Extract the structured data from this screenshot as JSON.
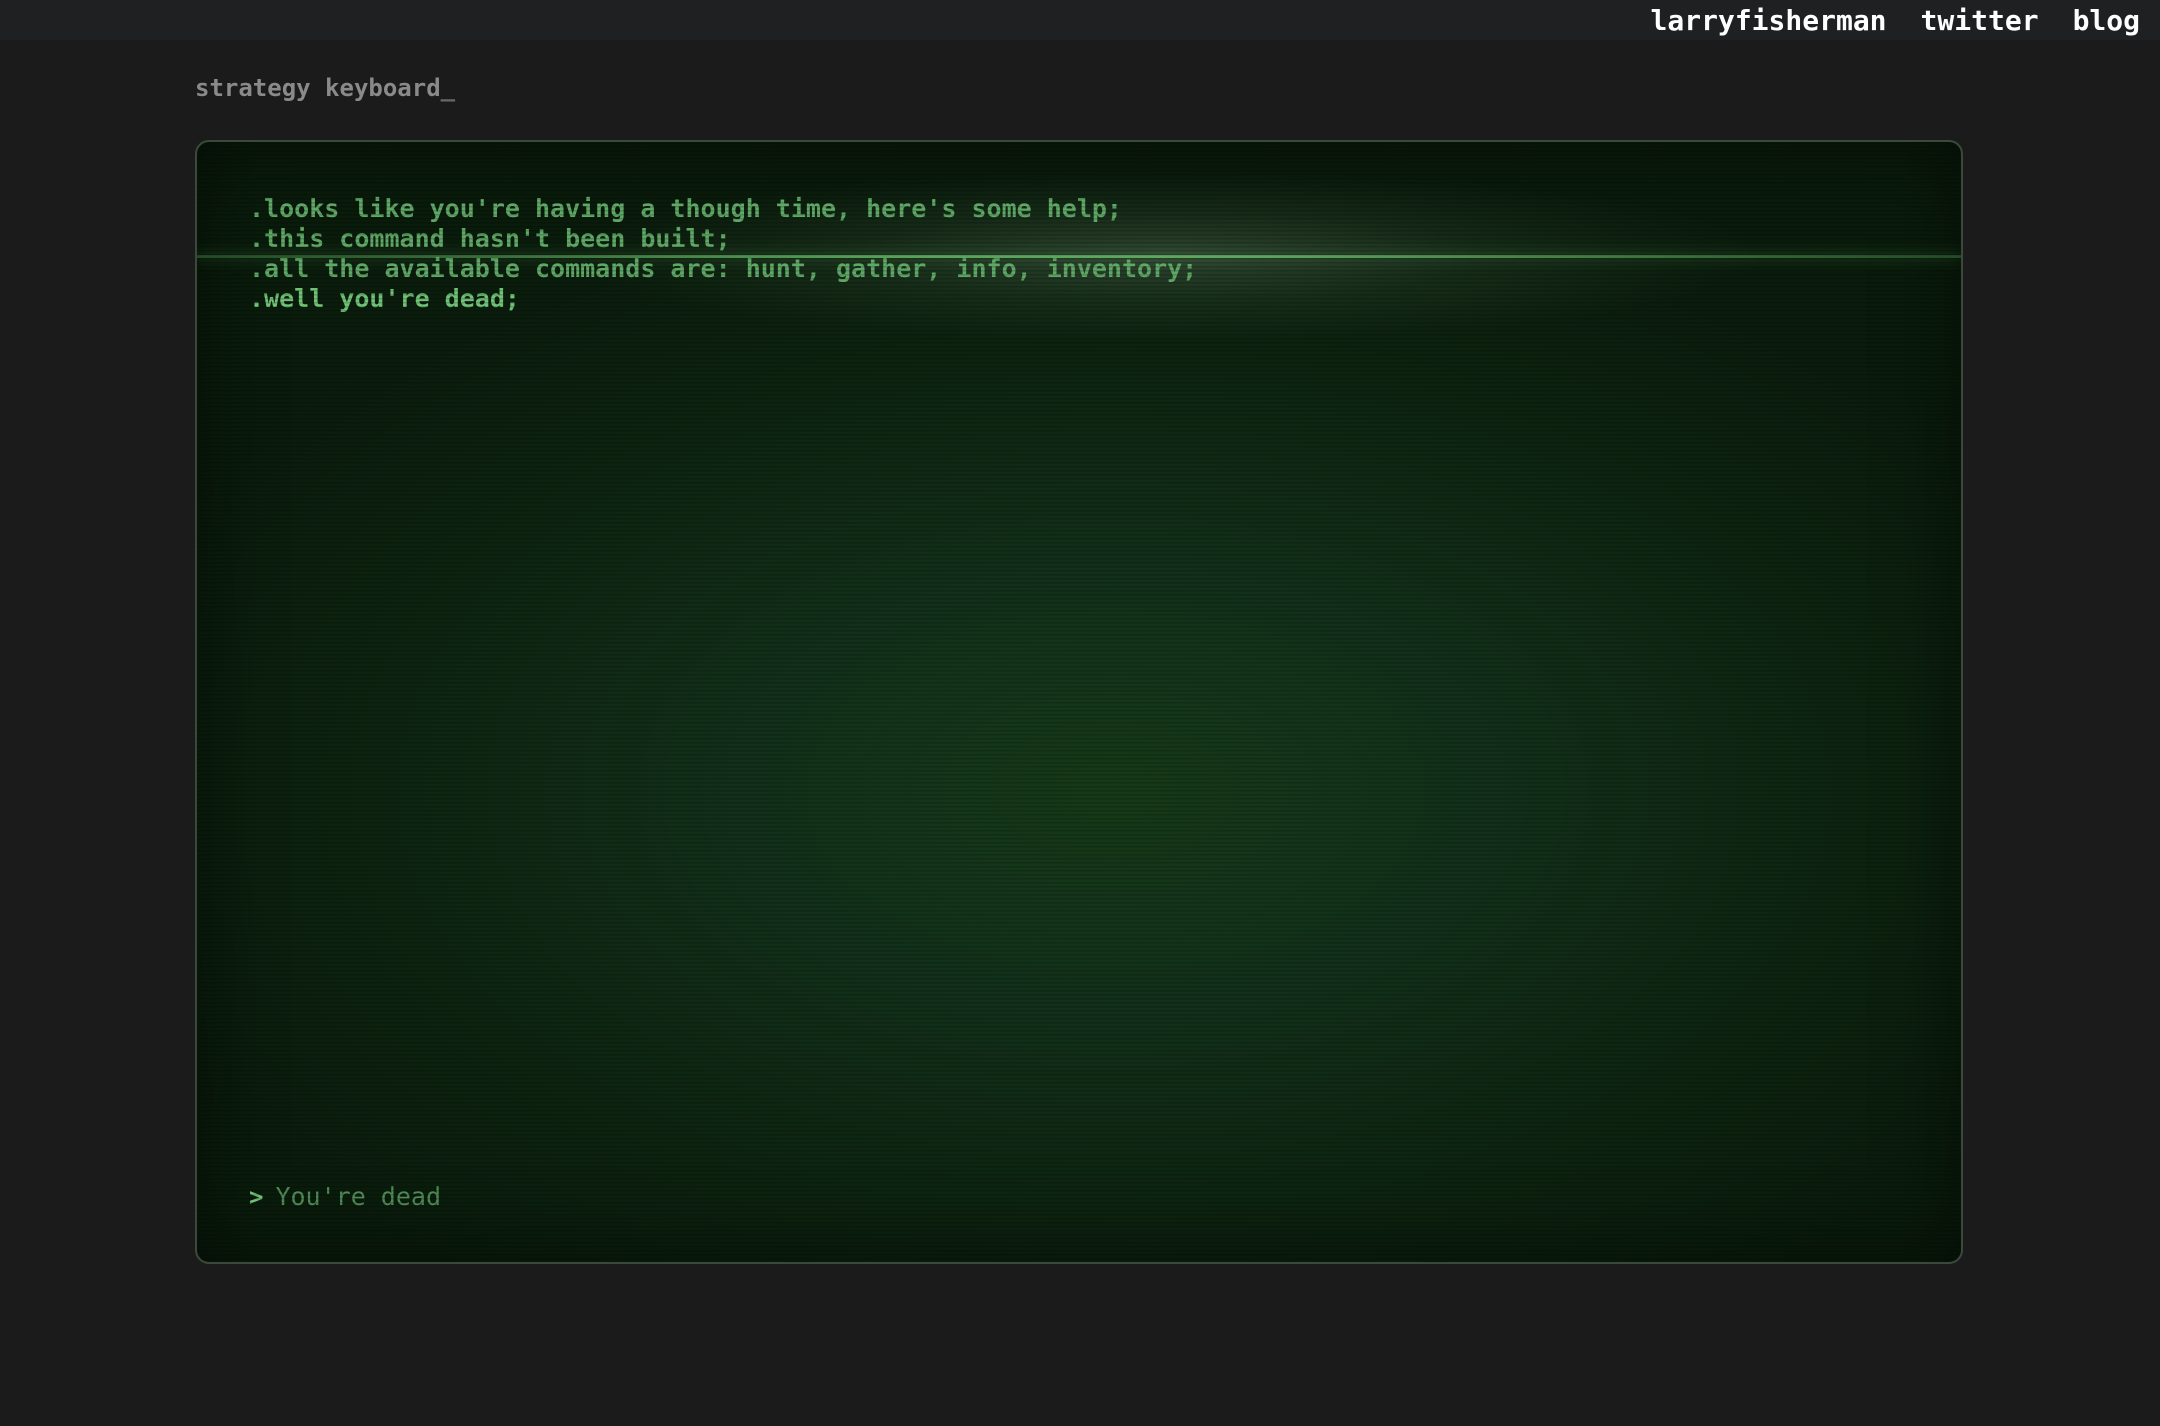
{
  "nav": {
    "links": [
      "larryfisherman",
      "twitter",
      "blog"
    ]
  },
  "site": {
    "title": "strategy keyboard",
    "cursor": "_"
  },
  "terminal": {
    "lines": [
      ".looks like you're having a though time, here's some help;",
      ".this command hasn't been built;",
      ".all the available commands are: hunt, gather, info, inventory;",
      ".well you're dead;"
    ],
    "prompt_symbol": ">",
    "input_value": "",
    "input_placeholder": "You're dead"
  },
  "colors": {
    "page_background": "#1b1b1b",
    "terminal_text": "#5fa866",
    "terminal_highlight": "#6fc276",
    "terminal_background": "#12301a"
  }
}
